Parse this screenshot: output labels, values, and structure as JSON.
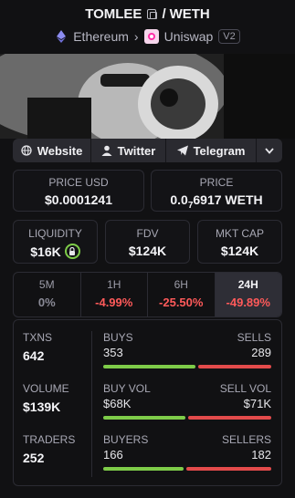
{
  "header": {
    "token": "TOMLEE",
    "quote": "WETH",
    "chain": "Ethereum",
    "dex": "Uniswap",
    "version": "V2"
  },
  "links": {
    "website": "Website",
    "twitter": "Twitter",
    "telegram": "Telegram"
  },
  "prices": {
    "usd_label": "PRICE USD",
    "usd_value": "$0.0001241",
    "price_label": "PRICE",
    "price_prefix": "0.0",
    "price_sub": "7",
    "price_rest": "6917 WETH"
  },
  "metrics": {
    "liquidity_label": "LIQUIDITY",
    "liquidity_value": "$16K",
    "fdv_label": "FDV",
    "fdv_value": "$124K",
    "mcap_label": "MKT CAP",
    "mcap_value": "$124K"
  },
  "timeframes": [
    {
      "label": "5M",
      "change": "0%",
      "color": "#8a8a96"
    },
    {
      "label": "1H",
      "change": "-4.99%",
      "color": "#ff5a5a"
    },
    {
      "label": "6H",
      "change": "-25.50%",
      "color": "#ff5a5a"
    },
    {
      "label": "24H",
      "change": "-49.89%",
      "color": "#ff5a5a"
    }
  ],
  "stats": {
    "txns_label": "TXNS",
    "txns": "642",
    "buys_label": "BUYS",
    "buys": "353",
    "sells_label": "SELLS",
    "sells": "289",
    "volume_label": "VOLUME",
    "volume": "$139K",
    "buyvol_label": "BUY VOL",
    "buyvol": "$68K",
    "sellvol_label": "SELL VOL",
    "sellvol": "$71K",
    "traders_label": "TRADERS",
    "traders": "252",
    "buyers_label": "BUYERS",
    "buyers": "166",
    "sellers_label": "SELLERS",
    "sellers": "182"
  },
  "colors": {
    "green": "#7ecc49",
    "red": "#e34b4b",
    "accent_lock": "#7ecc49"
  }
}
